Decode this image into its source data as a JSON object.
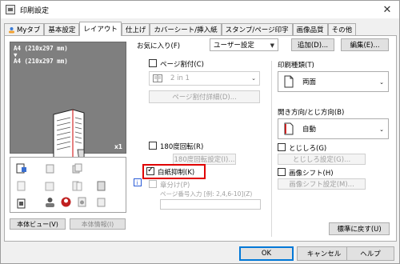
{
  "window": {
    "title": "印刷設定",
    "close_glyph": "✕"
  },
  "tabs": [
    {
      "label": "Myタブ"
    },
    {
      "label": "基本設定"
    },
    {
      "label": "レイアウト"
    },
    {
      "label": "仕上げ"
    },
    {
      "label": "カバーシート/挿入紙"
    },
    {
      "label": "スタンプ/ページ印字"
    },
    {
      "label": "画像品質"
    },
    {
      "label": "その他"
    }
  ],
  "preview": {
    "line1": "A4 (210x297 mm)",
    "line2": "▼",
    "line3": "A4 (210x297 mm)",
    "count": "x1"
  },
  "left_buttons": {
    "printer_view": "本体ビュー(V)",
    "printer_info": "本体情報(I)"
  },
  "favorites": {
    "label": "お気に入り(F)",
    "value": "ユーザー設定",
    "add": "追加(D)...",
    "edit": "編集(E)..."
  },
  "combine": {
    "checkbox": "ページ割付(C)",
    "value": "2 in 1",
    "details": "ページ割付詳細(D)..."
  },
  "rotate180": {
    "checkbox": "180度回転(R)",
    "settings": "180度回転設定(I)..."
  },
  "skip_blank": {
    "checkbox": "白紙抑制(K)",
    "checked": true
  },
  "chapters": {
    "checkbox": "章分け(P)",
    "page_input": "ページ番号入力 [例: 2,4,6-10](Z)"
  },
  "print_type": {
    "label": "印刷種類(T)",
    "value": "両面"
  },
  "binding": {
    "label": "開き方向/とじ方向(B)",
    "value": "自動"
  },
  "binding_margin": {
    "checkbox": "とじしろ(G)",
    "settings": "とじしろ設定(G)..."
  },
  "image_shift": {
    "checkbox": "画像シフト(H)",
    "settings": "画像シフト設定(M)..."
  },
  "reset": "標準に戻す(U)",
  "footer": {
    "ok": "OK",
    "cancel": "キャンセル",
    "help": "ヘルプ"
  },
  "colors": {
    "highlight": "#e00000",
    "primary_border": "#0078d7"
  }
}
